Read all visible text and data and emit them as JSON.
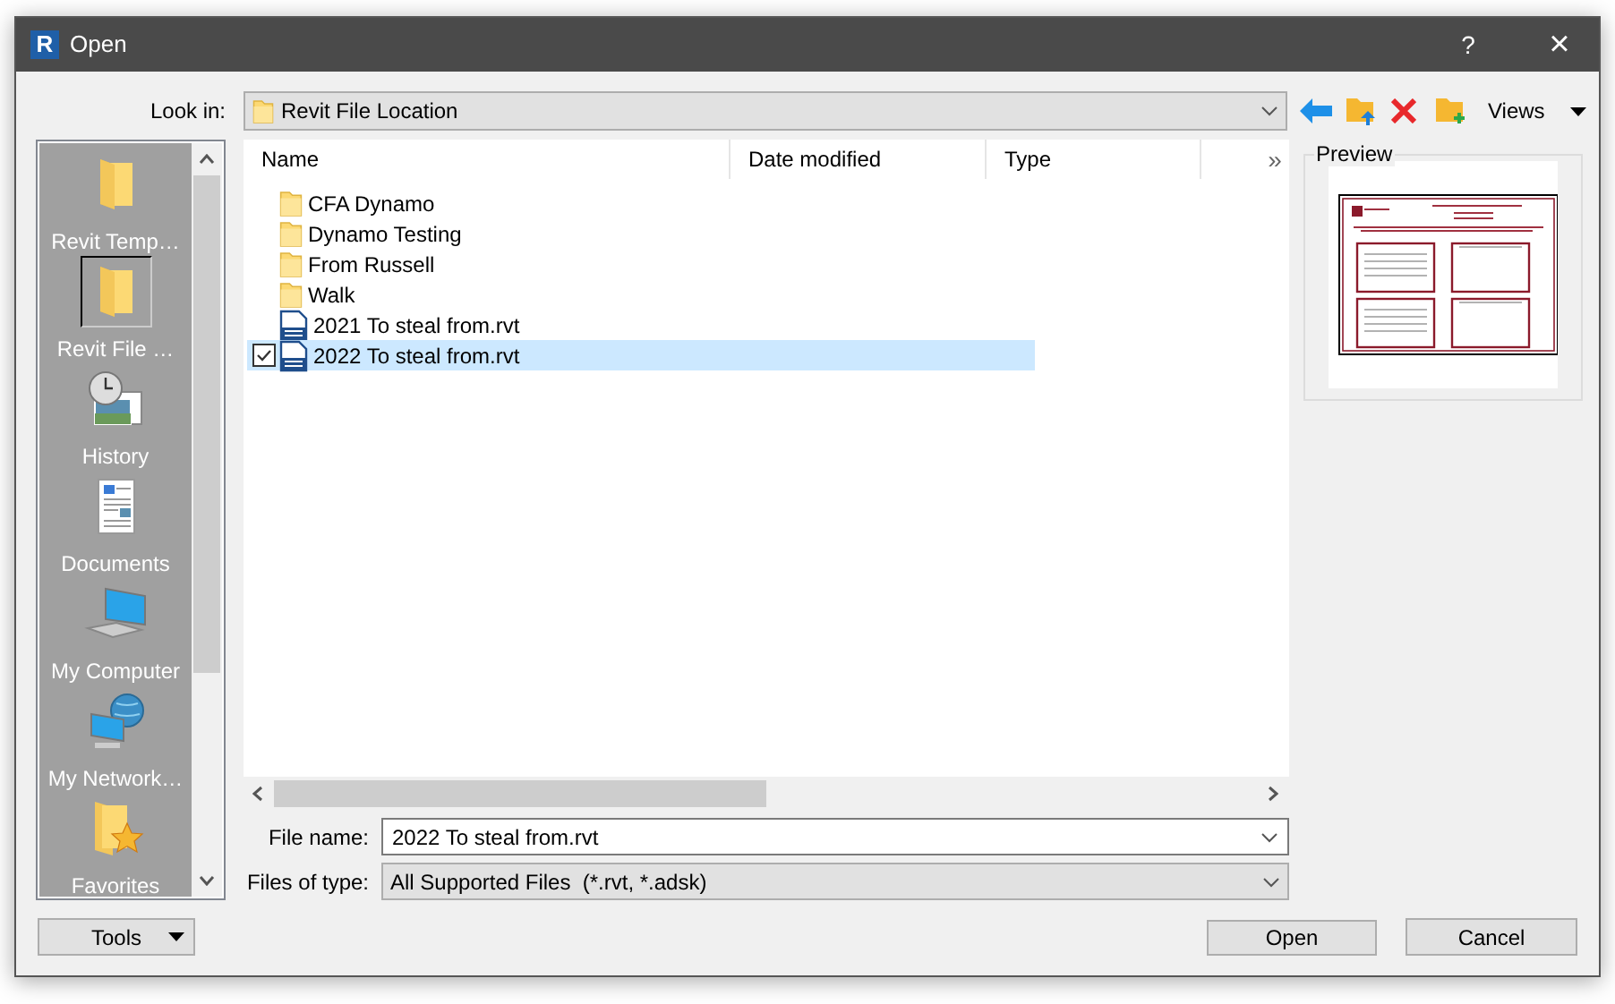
{
  "window": {
    "logo_letter": "R",
    "title": "Open",
    "help": "?",
    "close": "×"
  },
  "look_in": {
    "label": "Look in:",
    "value": "Revit File Location"
  },
  "toolbar": {
    "views": "Views"
  },
  "places": [
    {
      "label": "Revit Temp…",
      "kind": "folder",
      "selected": false
    },
    {
      "label": "Revit File …",
      "kind": "folder",
      "selected": true
    },
    {
      "label": "History",
      "kind": "history",
      "selected": false
    },
    {
      "label": "Documents",
      "kind": "documents",
      "selected": false
    },
    {
      "label": "My Computer",
      "kind": "computer",
      "selected": false
    },
    {
      "label": "My Network…",
      "kind": "network",
      "selected": false
    },
    {
      "label": "Favorites",
      "kind": "favorites",
      "selected": false
    }
  ],
  "columns": [
    "Name",
    "Date modified",
    "Type"
  ],
  "more_columns": "»",
  "files": [
    {
      "name": "CFA Dynamo",
      "kind": "folder",
      "selected": false,
      "checked": false
    },
    {
      "name": "Dynamo Testing",
      "kind": "folder",
      "selected": false,
      "checked": false
    },
    {
      "name": "From Russell",
      "kind": "folder",
      "selected": false,
      "checked": false
    },
    {
      "name": "Walk",
      "kind": "folder",
      "selected": false,
      "checked": false
    },
    {
      "name": "2021 To steal from.rvt",
      "kind": "rvt",
      "selected": false,
      "checked": false
    },
    {
      "name": "2022 To steal from.rvt",
      "kind": "rvt",
      "selected": true,
      "checked": true
    }
  ],
  "preview": {
    "label": "Preview"
  },
  "file_name": {
    "label": "File name:",
    "value": "2022 To steal from.rvt"
  },
  "file_type": {
    "label": "Files of type:",
    "value": "All Supported Files  (*.rvt, *.adsk)"
  },
  "buttons": {
    "tools": "Tools",
    "open": "Open",
    "cancel": "Cancel"
  }
}
